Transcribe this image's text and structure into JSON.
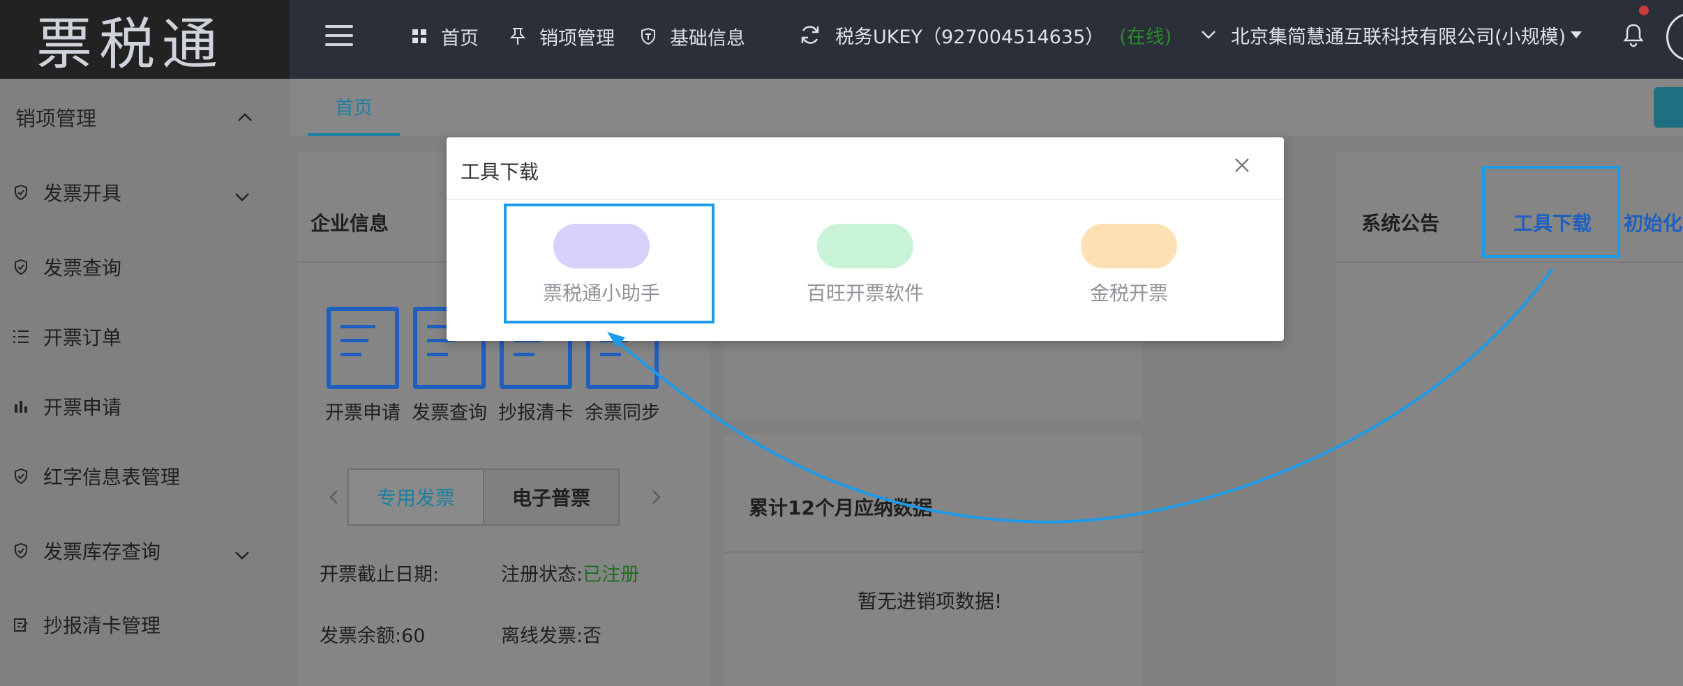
{
  "header": {
    "logo_text": "票税通",
    "nav": [
      {
        "label": "首页"
      },
      {
        "label": "销项管理"
      },
      {
        "label": "基础信息"
      }
    ],
    "ukey_label": "税务UKEY（927004514635）",
    "ukey_status": "(在线)",
    "company": "北京集简慧通互联科技有限公司(小规模)"
  },
  "sidebar": {
    "section": "销项管理",
    "items": [
      {
        "label": "发票开具",
        "icon": "shield-check-icon",
        "expandable": true
      },
      {
        "label": "发票查询",
        "icon": "shield-check-icon",
        "expandable": false
      },
      {
        "label": "开票订单",
        "icon": "list-icon",
        "expandable": false
      },
      {
        "label": "开票申请",
        "icon": "bar-chart-icon",
        "expandable": false
      },
      {
        "label": "红字信息表管理",
        "icon": "shield-check-icon",
        "expandable": false
      },
      {
        "label": "发票库存查询",
        "icon": "shield-check-icon",
        "expandable": true
      },
      {
        "label": "抄报清卡管理",
        "icon": "edit-icon",
        "expandable": false
      }
    ]
  },
  "tabs": {
    "home": "首页"
  },
  "company_card": {
    "title": "企业信息",
    "quick_actions": [
      "开票申请",
      "发票查询",
      "抄报清卡",
      "余票同步"
    ],
    "invoice_tabs": [
      "专用发票",
      "电子普票"
    ],
    "info": {
      "deadline_label": "开票截止日期:",
      "reg_label": "注册状态:",
      "reg_value": "已注册",
      "balance_label": "发票余额:",
      "balance_value": "60",
      "offline_label": "离线发票:",
      "offline_value": "否"
    }
  },
  "tax_card": {
    "title": "累计12个月应纳数据",
    "empty": "暂无进销项数据!"
  },
  "notice_card": {
    "title": "系统公告",
    "tool_download": "工具下载",
    "init": "初始化"
  },
  "dialog": {
    "title": "工具下载",
    "tools": [
      {
        "label": "票税通小助手",
        "color": "#d9d0fb"
      },
      {
        "label": "百旺开票软件",
        "color": "#c9f3d7"
      },
      {
        "label": "金税开票",
        "color": "#fee0b5"
      }
    ]
  },
  "colors": {
    "accent": "#1e7fa0",
    "highlight": "#1e9be8",
    "online": "#2c8a2c"
  }
}
